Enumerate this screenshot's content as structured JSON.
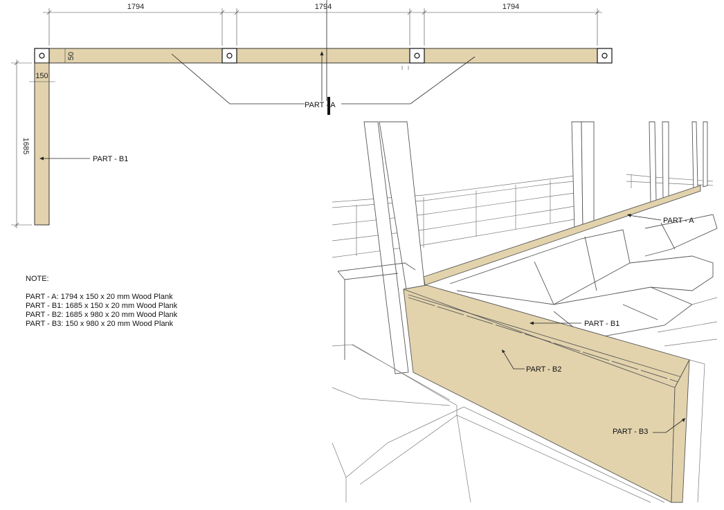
{
  "colors": {
    "wood": "#e2d3ad",
    "line": "#222222",
    "background": "#ffffff"
  },
  "plan": {
    "dimensions": {
      "span1": "1794",
      "span2": "1794",
      "span3": "1794",
      "plank_thickness": "150",
      "beam_height": "50",
      "side_length": "1685"
    },
    "labels": {
      "part_a": "PART - A",
      "part_b1": "PART - B1"
    }
  },
  "notes": {
    "heading": "NOTE:",
    "lines": [
      "PART - A: 1794 x 150 x 20 mm Wood Plank",
      "PART - B1: 1685 x 150 x 20 mm Wood Plank",
      "PART - B2: 1685 x 980 x 20 mm Wood Plank",
      "PART - B3: 150 x 980 x 20 mm Wood Plank"
    ]
  },
  "perspective": {
    "labels": {
      "part_a": "PART - A",
      "part_b1": "PART - B1",
      "part_b2": "PART - B2",
      "part_b3": "PART - B3"
    }
  }
}
